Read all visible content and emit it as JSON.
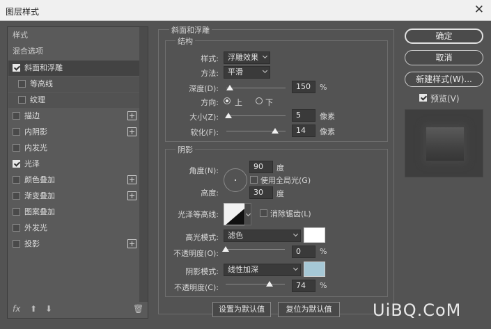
{
  "window": {
    "title": "图层样式",
    "close_glyph": "✕"
  },
  "left_panel": {
    "items": [
      {
        "label": "样式",
        "checkbox": false,
        "has_add": false,
        "type": "header"
      },
      {
        "label": "混合选项",
        "checkbox": false,
        "has_add": false,
        "type": "header"
      },
      {
        "label": "斜面和浮雕",
        "checkbox": true,
        "checked": true,
        "has_add": false,
        "selected": true
      },
      {
        "label": "等高线",
        "checkbox": true,
        "checked": false,
        "has_add": false,
        "sub": true
      },
      {
        "label": "纹理",
        "checkbox": true,
        "checked": false,
        "has_add": false,
        "sub": true
      },
      {
        "label": "描边",
        "checkbox": true,
        "checked": false,
        "has_add": true
      },
      {
        "label": "内阴影",
        "checkbox": true,
        "checked": false,
        "has_add": true
      },
      {
        "label": "内发光",
        "checkbox": true,
        "checked": false,
        "has_add": false
      },
      {
        "label": "光泽",
        "checkbox": true,
        "checked": true,
        "has_add": false
      },
      {
        "label": "颜色叠加",
        "checkbox": true,
        "checked": false,
        "has_add": true
      },
      {
        "label": "渐变叠加",
        "checkbox": true,
        "checked": false,
        "has_add": true
      },
      {
        "label": "图案叠加",
        "checkbox": true,
        "checked": false,
        "has_add": false
      },
      {
        "label": "外发光",
        "checkbox": true,
        "checked": false,
        "has_add": false
      },
      {
        "label": "投影",
        "checkbox": true,
        "checked": false,
        "has_add": true
      }
    ],
    "bottom": {
      "fx": "fx",
      "up": "⬆",
      "down": "⬇",
      "trash": "🗑"
    }
  },
  "bevel": {
    "section_title": "斜面和浮雕",
    "structure_title": "结构",
    "style_label": "样式:",
    "style_value": "浮雕效果",
    "method_label": "方法:",
    "method_value": "平滑",
    "depth_label": "深度(D):",
    "depth_value": "150",
    "depth_unit": "%",
    "depth_pos": 0.06,
    "direction_label": "方向:",
    "dir_up": "上",
    "dir_down": "下",
    "size_label": "大小(Z):",
    "size_value": "5",
    "size_unit": "像素",
    "size_pos": 0.03,
    "soften_label": "软化(F):",
    "soften_value": "14",
    "soften_unit": "像素",
    "soften_pos": 0.82
  },
  "shading": {
    "title": "阴影",
    "angle_label": "角度(N):",
    "angle_value": "90",
    "angle_unit": "度",
    "global_light_label": "使用全局光(G)",
    "altitude_label": "高度:",
    "altitude_value": "30",
    "altitude_unit": "度",
    "gloss_label": "光泽等高线:",
    "antialias_label": "消除锯齿(L)",
    "highlight_label": "高光模式:",
    "highlight_mode": "滤色",
    "highlight_color": "#ffffff",
    "hl_opacity_label": "不透明度(O):",
    "hl_opacity_value": "0",
    "hl_opacity_unit": "%",
    "hl_opacity_pos": 0.0,
    "shadow_label": "阴影模式:",
    "shadow_mode": "线性加深",
    "shadow_color": "#a6c8d6",
    "sh_opacity_label": "不透明度(C):",
    "sh_opacity_value": "74",
    "sh_opacity_unit": "%",
    "sh_opacity_pos": 0.74
  },
  "buttons": {
    "set_default": "设置为默认值",
    "reset_default": "复位为默认值",
    "ok": "确定",
    "cancel": "取消",
    "new_style": "新建样式(W)...",
    "preview": "预览(V)"
  },
  "watermark": "UiBQ.CoM"
}
